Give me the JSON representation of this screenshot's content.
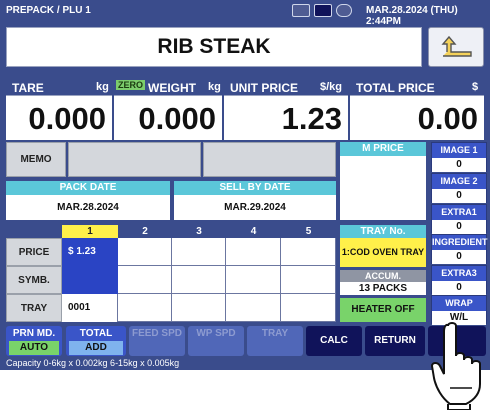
{
  "topbar": {
    "mode": "PREPACK / PLU 1",
    "datetime": "MAR.28.2024 (THU)  2:44PM",
    "icons": [
      "monitor-icon",
      "battery-icon",
      "network-icon"
    ]
  },
  "product": {
    "name": "RIB STEAK"
  },
  "display": {
    "tare": {
      "label": "TARE",
      "unit": "kg",
      "value": "0.000"
    },
    "weight": {
      "zero": "ZERO",
      "label": "WEIGHT",
      "unit": "kg",
      "value": "0.000"
    },
    "unit_price": {
      "label": "UNIT PRICE",
      "unit": "$/kg",
      "value": "1.23"
    },
    "total_price": {
      "label": "TOTAL PRICE",
      "unit": "$",
      "value": "0.00"
    }
  },
  "memo": {
    "label": "MEMO"
  },
  "mprice": {
    "label": "M PRICE"
  },
  "dates": {
    "pack": {
      "label": "PACK DATE",
      "value": "MAR.28.2024"
    },
    "sell": {
      "label": "SELL BY DATE",
      "value": "MAR.29.2024"
    }
  },
  "grid": {
    "columns": [
      "1",
      "2",
      "3",
      "4",
      "5"
    ],
    "rows": [
      {
        "label": "PRICE",
        "first": "$ 1.23"
      },
      {
        "label": "SYMB.",
        "first": ""
      },
      {
        "label": "TRAY",
        "first": "0001"
      }
    ]
  },
  "tray": {
    "label": "TRAY No.",
    "value": "1:COD OVEN TRAY"
  },
  "accum": {
    "label": "ACCUM.",
    "value": "13 PACKS"
  },
  "heater": {
    "label": "HEATER OFF"
  },
  "side": [
    {
      "label": "IMAGE 1",
      "value": "0"
    },
    {
      "label": "IMAGE 2",
      "value": "0"
    },
    {
      "label": "EXTRA1",
      "value": "0"
    },
    {
      "label": "INGREDIENT",
      "value": "0"
    },
    {
      "label": "EXTRA3",
      "value": "0"
    },
    {
      "label": "WRAP MODE",
      "value": "W/L"
    }
  ],
  "bottom": {
    "prn_md": {
      "label": "PRN MD.",
      "value": "AUTO"
    },
    "total": {
      "label": "TOTAL",
      "value": "ADD"
    },
    "feed_spd": "FEED SPD",
    "wp_spd": "WP SPD",
    "tray": "TRAY",
    "calc": "CALC",
    "return": "RETURN"
  },
  "status": {
    "capacity": "Capacity 0-6kg x 0.002kg  6-15kg x 0.005kg"
  },
  "colors": {
    "navy": "#3a4c8c",
    "cyan": "#5bc7d9",
    "yellow": "#fff04a",
    "green": "#79d36a",
    "blue": "#2a44c4"
  }
}
